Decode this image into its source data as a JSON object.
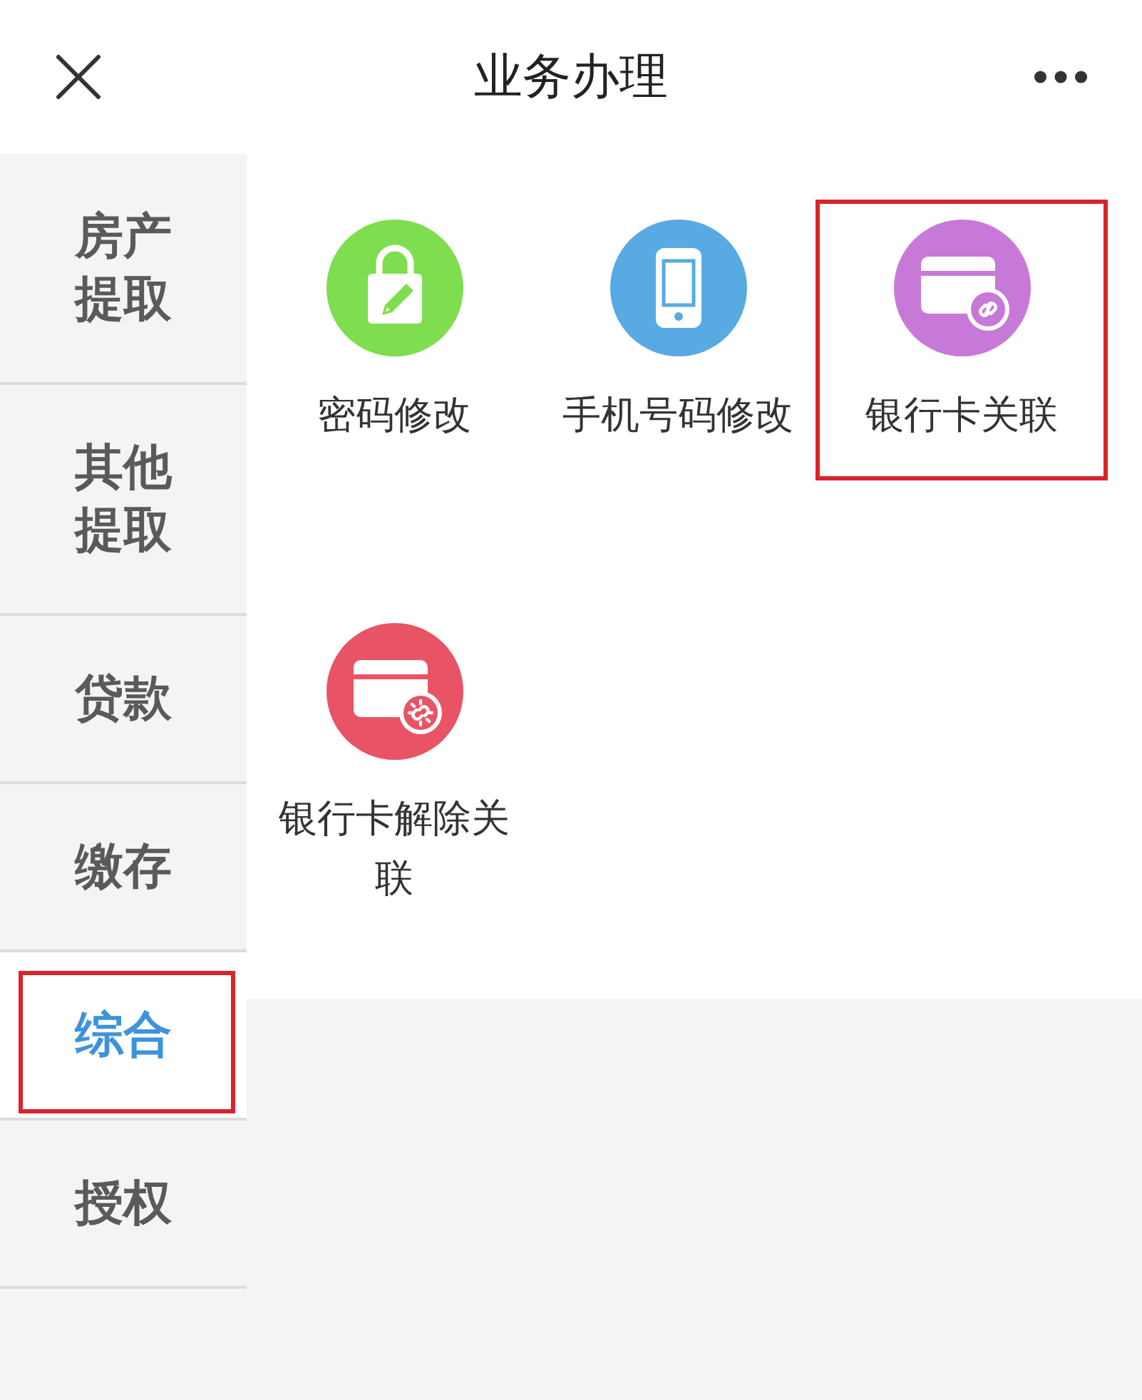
{
  "header": {
    "title": "业务办理"
  },
  "sidebar": {
    "items": [
      {
        "label": "房产提取",
        "selected": false,
        "highlighted": false
      },
      {
        "label": "其他提取",
        "selected": false,
        "highlighted": false
      },
      {
        "label": "贷款",
        "selected": false,
        "highlighted": false
      },
      {
        "label": "缴存",
        "selected": false,
        "highlighted": false
      },
      {
        "label": "综合",
        "selected": true,
        "highlighted": true
      },
      {
        "label": "授权",
        "selected": false,
        "highlighted": false
      }
    ]
  },
  "services": {
    "items": [
      {
        "label": "密码修改",
        "kind": "lock",
        "color": "#7fde4f",
        "highlighted": false
      },
      {
        "label": "手机号码修改",
        "kind": "phone",
        "color": "#59a9e3",
        "highlighted": false
      },
      {
        "label": "银行卡关联",
        "kind": "card-link",
        "color": "#c779d8",
        "highlighted": true
      },
      {
        "label": "银行卡解除关联",
        "kind": "card-unlink",
        "color": "#e85466",
        "highlighted": false
      }
    ]
  }
}
